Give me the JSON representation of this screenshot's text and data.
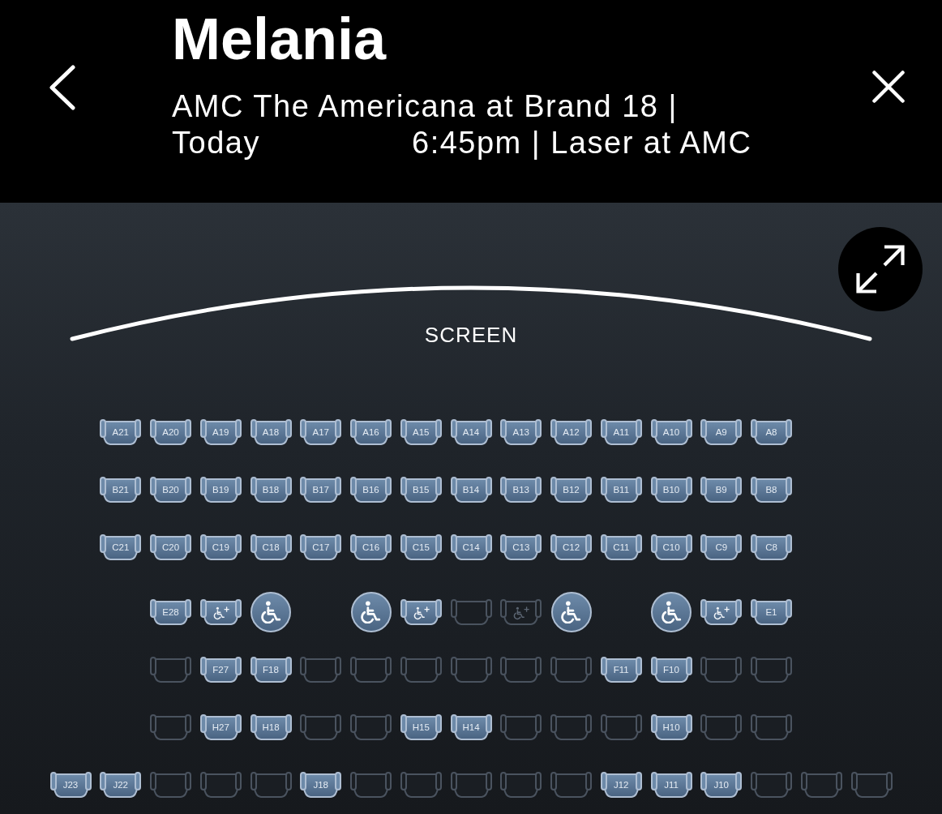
{
  "header": {
    "title": "Melania",
    "venue": "AMC The Americana at Brand 18 |",
    "date": "Today",
    "showtime": "6:45pm | Laser at AMC"
  },
  "seat_map": {
    "screen_label": "SCREEN",
    "rows": [
      {
        "seats": [
          {
            "kind": "gap"
          },
          {
            "kind": "standard",
            "label": "A21",
            "available": true
          },
          {
            "kind": "standard",
            "label": "A20",
            "available": true
          },
          {
            "kind": "standard",
            "label": "A19",
            "available": true
          },
          {
            "kind": "standard",
            "label": "A18",
            "available": true
          },
          {
            "kind": "standard",
            "label": "A17",
            "available": true
          },
          {
            "kind": "standard",
            "label": "A16",
            "available": true
          },
          {
            "kind": "standard",
            "label": "A15",
            "available": true
          },
          {
            "kind": "standard",
            "label": "A14",
            "available": true
          },
          {
            "kind": "standard",
            "label": "A13",
            "available": true
          },
          {
            "kind": "standard",
            "label": "A12",
            "available": true
          },
          {
            "kind": "standard",
            "label": "A11",
            "available": true
          },
          {
            "kind": "standard",
            "label": "A10",
            "available": true
          },
          {
            "kind": "standard",
            "label": "A9",
            "available": true
          },
          {
            "kind": "standard",
            "label": "A8",
            "available": true
          }
        ]
      },
      {
        "seats": [
          {
            "kind": "gap"
          },
          {
            "kind": "standard",
            "label": "B21",
            "available": true
          },
          {
            "kind": "standard",
            "label": "B20",
            "available": true
          },
          {
            "kind": "standard",
            "label": "B19",
            "available": true
          },
          {
            "kind": "standard",
            "label": "B18",
            "available": true
          },
          {
            "kind": "standard",
            "label": "B17",
            "available": true
          },
          {
            "kind": "standard",
            "label": "B16",
            "available": true
          },
          {
            "kind": "standard",
            "label": "B15",
            "available": true
          },
          {
            "kind": "standard",
            "label": "B14",
            "available": true
          },
          {
            "kind": "standard",
            "label": "B13",
            "available": true
          },
          {
            "kind": "standard",
            "label": "B12",
            "available": true
          },
          {
            "kind": "standard",
            "label": "B11",
            "available": true
          },
          {
            "kind": "standard",
            "label": "B10",
            "available": true
          },
          {
            "kind": "standard",
            "label": "B9",
            "available": true
          },
          {
            "kind": "standard",
            "label": "B8",
            "available": true
          }
        ]
      },
      {
        "seats": [
          {
            "kind": "gap"
          },
          {
            "kind": "standard",
            "label": "C21",
            "available": true
          },
          {
            "kind": "standard",
            "label": "C20",
            "available": true
          },
          {
            "kind": "standard",
            "label": "C19",
            "available": true
          },
          {
            "kind": "standard",
            "label": "C18",
            "available": true
          },
          {
            "kind": "standard",
            "label": "C17",
            "available": true
          },
          {
            "kind": "standard",
            "label": "C16",
            "available": true
          },
          {
            "kind": "standard",
            "label": "C15",
            "available": true
          },
          {
            "kind": "standard",
            "label": "C14",
            "available": true
          },
          {
            "kind": "standard",
            "label": "C13",
            "available": true
          },
          {
            "kind": "standard",
            "label": "C12",
            "available": true
          },
          {
            "kind": "standard",
            "label": "C11",
            "available": true
          },
          {
            "kind": "standard",
            "label": "C10",
            "available": true
          },
          {
            "kind": "standard",
            "label": "C9",
            "available": true
          },
          {
            "kind": "standard",
            "label": "C8",
            "available": true
          }
        ]
      },
      {
        "seats": [
          {
            "kind": "gap"
          },
          {
            "kind": "gap"
          },
          {
            "kind": "standard",
            "label": "E28",
            "available": true
          },
          {
            "kind": "companion",
            "available": true
          },
          {
            "kind": "wheelchair",
            "available": true
          },
          {
            "kind": "gap"
          },
          {
            "kind": "wheelchair",
            "available": true
          },
          {
            "kind": "companion",
            "available": true
          },
          {
            "kind": "standard",
            "available": false
          },
          {
            "kind": "companion",
            "available": false
          },
          {
            "kind": "wheelchair",
            "available": true
          },
          {
            "kind": "gap"
          },
          {
            "kind": "wheelchair",
            "available": true
          },
          {
            "kind": "companion",
            "available": true
          },
          {
            "kind": "standard",
            "label": "E1",
            "available": true
          }
        ]
      },
      {
        "seats": [
          {
            "kind": "gap"
          },
          {
            "kind": "gap"
          },
          {
            "kind": "standard",
            "available": false
          },
          {
            "kind": "standard",
            "label": "F27",
            "available": true
          },
          {
            "kind": "standard",
            "label": "F18",
            "available": true
          },
          {
            "kind": "standard",
            "available": false
          },
          {
            "kind": "standard",
            "available": false
          },
          {
            "kind": "standard",
            "available": false
          },
          {
            "kind": "standard",
            "available": false
          },
          {
            "kind": "standard",
            "available": false
          },
          {
            "kind": "standard",
            "available": false
          },
          {
            "kind": "standard",
            "label": "F11",
            "available": true
          },
          {
            "kind": "standard",
            "label": "F10",
            "available": true
          },
          {
            "kind": "standard",
            "available": false
          },
          {
            "kind": "standard",
            "available": false
          }
        ]
      },
      {
        "seats": [
          {
            "kind": "gap"
          },
          {
            "kind": "gap"
          },
          {
            "kind": "standard",
            "available": false
          },
          {
            "kind": "standard",
            "label": "H27",
            "available": true
          },
          {
            "kind": "standard",
            "label": "H18",
            "available": true
          },
          {
            "kind": "standard",
            "available": false
          },
          {
            "kind": "standard",
            "available": false
          },
          {
            "kind": "standard",
            "label": "H15",
            "available": true
          },
          {
            "kind": "standard",
            "label": "H14",
            "available": true
          },
          {
            "kind": "standard",
            "available": false
          },
          {
            "kind": "standard",
            "available": false
          },
          {
            "kind": "standard",
            "available": false
          },
          {
            "kind": "standard",
            "label": "H10",
            "available": true
          },
          {
            "kind": "standard",
            "available": false
          },
          {
            "kind": "standard",
            "available": false
          }
        ]
      },
      {
        "seats": [
          {
            "kind": "standard",
            "label": "J23",
            "available": true
          },
          {
            "kind": "standard",
            "label": "J22",
            "available": true
          },
          {
            "kind": "standard",
            "available": false
          },
          {
            "kind": "standard",
            "available": false
          },
          {
            "kind": "standard",
            "available": false
          },
          {
            "kind": "standard",
            "label": "J18",
            "available": true
          },
          {
            "kind": "standard",
            "available": false
          },
          {
            "kind": "standard",
            "available": false
          },
          {
            "kind": "standard",
            "available": false
          },
          {
            "kind": "standard",
            "available": false
          },
          {
            "kind": "standard",
            "available": false
          },
          {
            "kind": "standard",
            "label": "J12",
            "available": true
          },
          {
            "kind": "standard",
            "label": "J11",
            "available": true
          },
          {
            "kind": "standard",
            "label": "J10",
            "available": true
          },
          {
            "kind": "standard",
            "available": false
          },
          {
            "kind": "standard",
            "available": false
          },
          {
            "kind": "standard",
            "available": false
          }
        ]
      }
    ]
  }
}
